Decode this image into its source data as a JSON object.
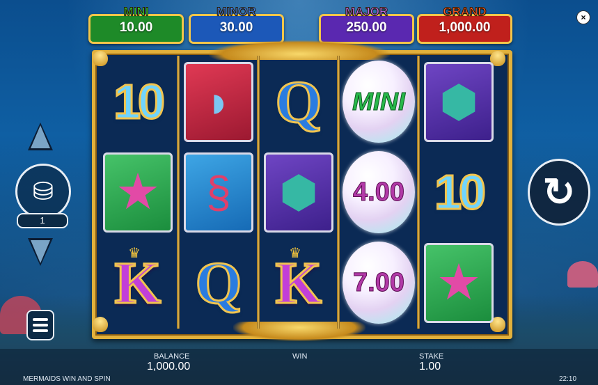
{
  "jackpots": [
    {
      "label": "MINI",
      "value": "10.00",
      "label_color": "#35d43a",
      "box_color": "#1e8a28"
    },
    {
      "label": "MINOR",
      "value": "30.00",
      "label_color": "#3a7ef0",
      "box_color": "#1c58b8"
    },
    {
      "label": "MAJOR",
      "value": "250.00",
      "label_color": "#b86cf0",
      "box_color": "#5a28b0"
    },
    {
      "label": "GRAND",
      "value": "1,000.00",
      "label_color": "#ff5a2a",
      "box_color": "#c0201c"
    }
  ],
  "close_icon": "×",
  "reels": [
    [
      "10",
      "dolphin",
      "Q"
    ],
    [
      "10",
      "seahorse",
      "Q"
    ],
    [
      "Q",
      "turtle",
      "K"
    ],
    [
      "MINI",
      "4.00",
      "7.00"
    ],
    [
      "turtle",
      "10",
      "starfish"
    ]
  ],
  "symbols": {
    "reel1_row1": "10",
    "reel1_row3": "K",
    "reel2_row3": "Q",
    "reel3_row1": "Q",
    "reel3_row3": "K",
    "reel4_row1": "MINI",
    "reel4_row2": "4.00",
    "reel4_row3": "7.00",
    "reel5_row2": "10"
  },
  "controls": {
    "bet_count": "1"
  },
  "footer": {
    "balance_label": "BALANCE",
    "balance_value": "1,000.00",
    "win_label": "WIN",
    "stake_label": "STAKE",
    "stake_value": "1.00",
    "game_name": "MERMAIDS WIN AND SPIN",
    "clock": "22:10"
  }
}
